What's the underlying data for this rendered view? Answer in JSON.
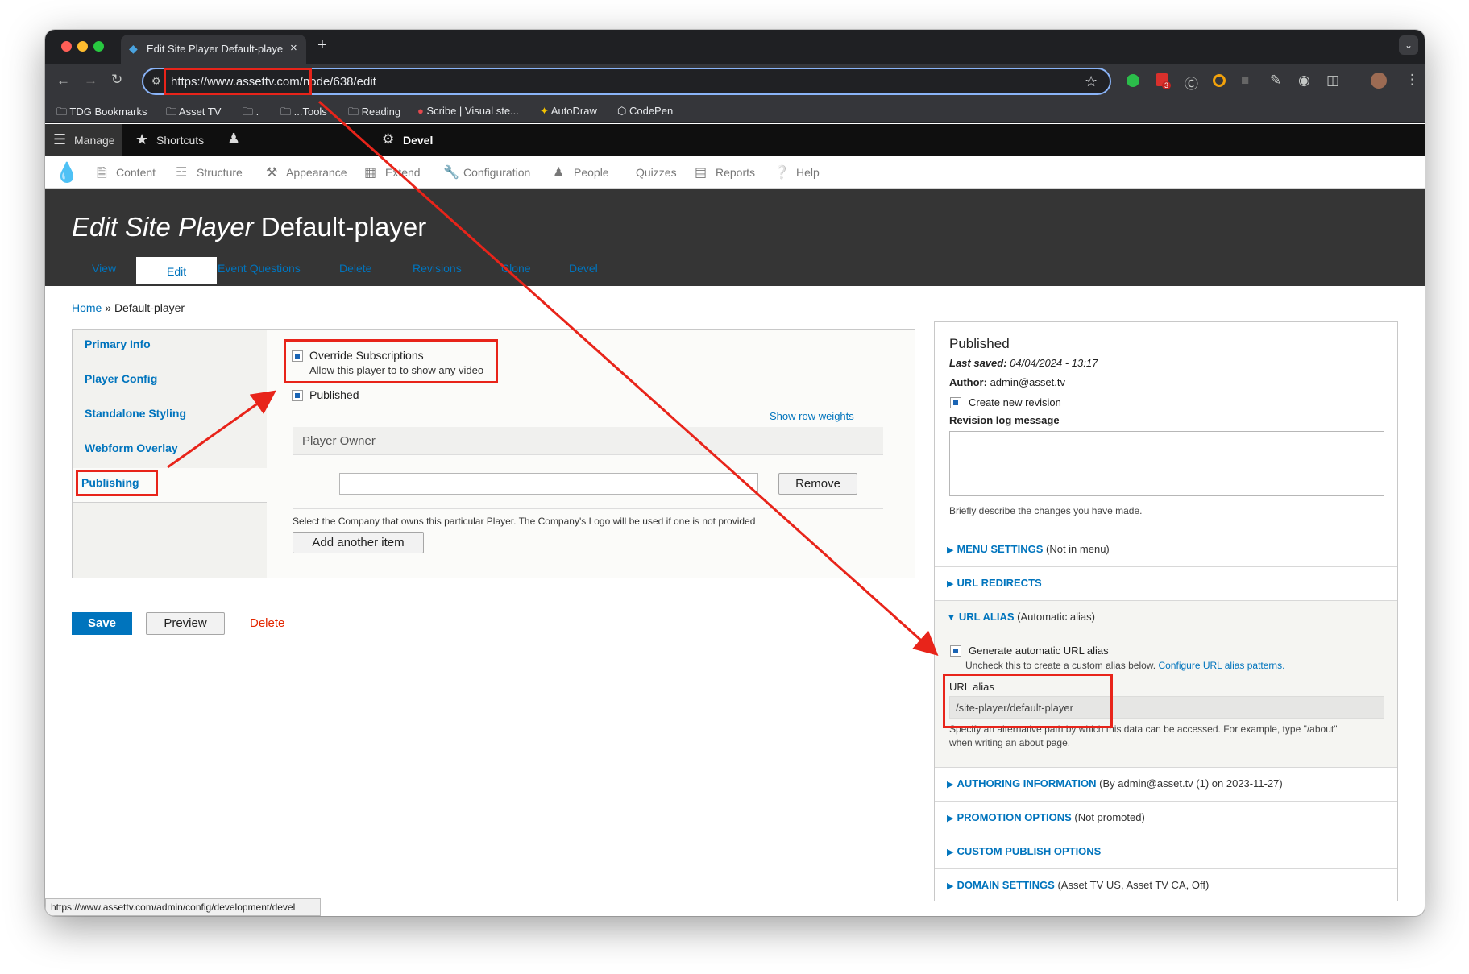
{
  "browser": {
    "tab_title": "Edit Site Player Default-playe",
    "url": "https://www.assettv.com/node/638/edit",
    "extension_badge": "3",
    "status_url": "https://www.assettv.com/admin/config/development/devel"
  },
  "bookmarks": [
    "TDG Bookmarks",
    "Asset TV",
    ".",
    "...Tools",
    "Reading",
    "Scribe | Visual ste...",
    "AutoDraw",
    "CodePen"
  ],
  "drupal": {
    "toolbar": {
      "manage": "Manage",
      "shortcuts": "Shortcuts",
      "devel": "Devel"
    },
    "menu": [
      "Content",
      "Structure",
      "Appearance",
      "Extend",
      "Configuration",
      "People",
      "Quizzes",
      "Reports",
      "Help"
    ]
  },
  "page": {
    "title_prefix": "Edit Site Player",
    "title_suffix": "Default-player",
    "tabs": [
      "View",
      "Edit",
      "Event Questions",
      "Delete",
      "Revisions",
      "Clone",
      "Devel"
    ],
    "breadcrumb": [
      "Home",
      "Default-player"
    ]
  },
  "form": {
    "vtabs": [
      "Primary Info",
      "Player Config",
      "Standalone Styling",
      "Webform Overlay",
      "Publishing"
    ],
    "override": {
      "label": "Override Subscriptions",
      "desc": "Allow this player to to show any video"
    },
    "published_label": "Published",
    "show_row_weights": "Show row weights",
    "player_owner": {
      "title": "Player Owner",
      "remove": "Remove",
      "desc": "Select the Company that owns this particular Player. The Company's Logo will be used if one is not provided",
      "add_another": "Add another item"
    },
    "actions": {
      "save": "Save",
      "preview": "Preview",
      "delete": "Delete"
    }
  },
  "sidebar": {
    "status": "Published",
    "last_saved_label": "Last saved:",
    "last_saved_value": "04/04/2024 - 13:17",
    "author_label": "Author:",
    "author_value": "admin@asset.tv",
    "create_revision": "Create new revision",
    "revision_log_label": "Revision log message",
    "revision_log_desc": "Briefly describe the changes you have made.",
    "sections": [
      {
        "title": "MENU SETTINGS",
        "summary": "(Not in menu)"
      },
      {
        "title": "URL REDIRECTS",
        "summary": ""
      },
      {
        "title": "URL ALIAS",
        "summary": "(Automatic alias)"
      },
      {
        "title": "AUTHORING INFORMATION",
        "summary": "(By admin@asset.tv (1) on 2023-11-27)"
      },
      {
        "title": "PROMOTION OPTIONS",
        "summary": "(Not promoted)"
      },
      {
        "title": "CUSTOM PUBLISH OPTIONS",
        "summary": ""
      },
      {
        "title": "DOMAIN SETTINGS",
        "summary": "(Asset TV US, Asset TV CA, Off)"
      }
    ],
    "url_alias": {
      "generate_label": "Generate automatic URL alias",
      "generate_desc": "Uncheck this to create a custom alias below.",
      "configure_link": "Configure URL alias patterns.",
      "alias_label": "URL alias",
      "value": "/site-player/default-player",
      "desc1": "Specify an alternative path by which this data can be accessed. For example, type \"/about\"",
      "desc2": "when writing an about page."
    }
  },
  "colors": {
    "accent": "#0074bd",
    "annotation": "#e8241a",
    "delete": "#e32700"
  }
}
